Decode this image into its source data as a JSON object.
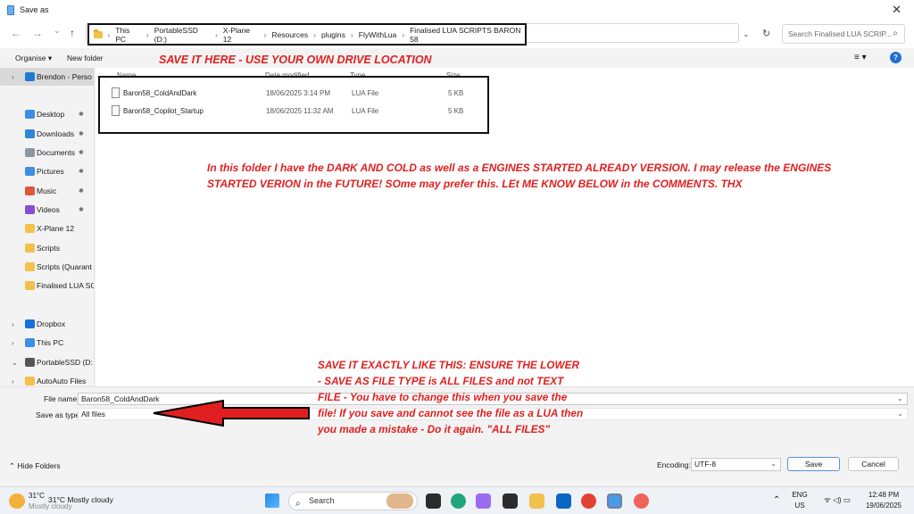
{
  "window": {
    "title": "Save as",
    "close_label": "✕"
  },
  "nav": {
    "back": "←",
    "forward": "→",
    "recent": "⌄",
    "up": "↑",
    "breadcrumbs": [
      "This PC",
      "PortableSSD (D:)",
      "X-Plane 12",
      "Resources",
      "plugins",
      "FlyWithLua",
      "Finalised LUA SCRIPTS BARON 58"
    ],
    "separator": "›",
    "search_placeholder": "Search Finalised LUA SCRIP...",
    "dropdown": "⌄",
    "refresh": "↻",
    "search_icon": "⌕"
  },
  "commands": {
    "organise": "Organise ▾",
    "new_folder": "New folder",
    "view": "≡ ▾",
    "help": "?"
  },
  "sidebar": {
    "items": [
      {
        "label": "Brendon - Perso",
        "chev": "›",
        "color": "#1e78d6",
        "pin": ""
      },
      {
        "label": "Desktop",
        "chev": "",
        "color": "#3a8ee6",
        "pin": "✱"
      },
      {
        "label": "Downloads",
        "chev": "",
        "color": "#2f86d9",
        "pin": "✱"
      },
      {
        "label": "Documents",
        "chev": "",
        "color": "#8f96a3",
        "pin": "✱"
      },
      {
        "label": "Pictures",
        "chev": "",
        "color": "#3c8fe0",
        "pin": "✱"
      },
      {
        "label": "Music",
        "chev": "",
        "color": "#e0563a",
        "pin": "✱"
      },
      {
        "label": "Videos",
        "chev": "",
        "color": "#8a4bd6",
        "pin": "✱"
      },
      {
        "label": "X-Plane 12",
        "chev": "",
        "color": "#f2c04b",
        "pin": ""
      },
      {
        "label": "Scripts",
        "chev": "",
        "color": "#f2c04b",
        "pin": ""
      },
      {
        "label": "Scripts (Quarant",
        "chev": "",
        "color": "#f2c04b",
        "pin": ""
      },
      {
        "label": "Finalised LUA SC",
        "chev": "",
        "color": "#f2c04b",
        "pin": ""
      },
      {
        "label": "Dropbox",
        "chev": "›",
        "color": "#1a6fe0",
        "pin": ""
      },
      {
        "label": "This PC",
        "chev": "›",
        "color": "#3a8ee6",
        "pin": ""
      },
      {
        "label": "PortableSSD (D:",
        "chev": "⌄",
        "color": "#555555",
        "pin": ""
      },
      {
        "label": "AutoAuto Files",
        "chev": "›",
        "color": "#f2c04b",
        "pin": ""
      }
    ]
  },
  "list": {
    "columns": [
      "Name",
      "Date modified",
      "Type",
      "Size"
    ],
    "files": [
      {
        "name": "Baron58_ColdAndDark",
        "date": "18/06/2025 3:14 PM",
        "type": "LUA File",
        "size": "5 KB"
      },
      {
        "name": "Baron58_Copilot_Startup",
        "date": "18/06/2025 11:32 AM",
        "type": "LUA File",
        "size": "5 KB"
      }
    ]
  },
  "annotations": {
    "top": "SAVE IT HERE - USE YOUR OWN DRIVE LOCATION",
    "middle": "In this folder I have the DARK AND COLD as well as a ENGINES STARTED ALREADY VERSION. I may release the ENGINES STARTED VERION in the FUTURE! SOme may prefer this. LEt ME KNOW BELOW in the COMMENTS. THX",
    "bottom": "SAVE IT EXACTLY LIKE THIS: ENSURE THE LOWER  - SAVE AS FILE TYPE is ALL FILES and not TEXT FILE - You have to change this when you save the file! If you save and cannot see the file as a LUA then you made a mistake - Do it again. \"ALL FILES\"",
    "color": "#e02020"
  },
  "save_form": {
    "file_name_label": "File name:",
    "file_name_value": "Baron58_ColdAndDark",
    "save_type_label": "Save as type:",
    "save_type_value": "All files",
    "dd": "⌄",
    "hide_folders": "⌃ Hide Folders",
    "encoding_label": "Encoding:",
    "encoding_value": "UTF-8",
    "save_button": "Save",
    "cancel_button": "Cancel"
  },
  "taskbar": {
    "weather_temp": "31°C",
    "weather_text": "31°C Mostly cloudy",
    "weather_sub": "Mostly cloudy",
    "search_label": "Search",
    "search_icon": "⌕",
    "lang_top": "ENG",
    "lang_bottom": "US",
    "time": "12:48 PM",
    "date": "19/06/2025",
    "tray_up": "⌃",
    "tray_icons": "ᯤ ◁) ▭"
  }
}
